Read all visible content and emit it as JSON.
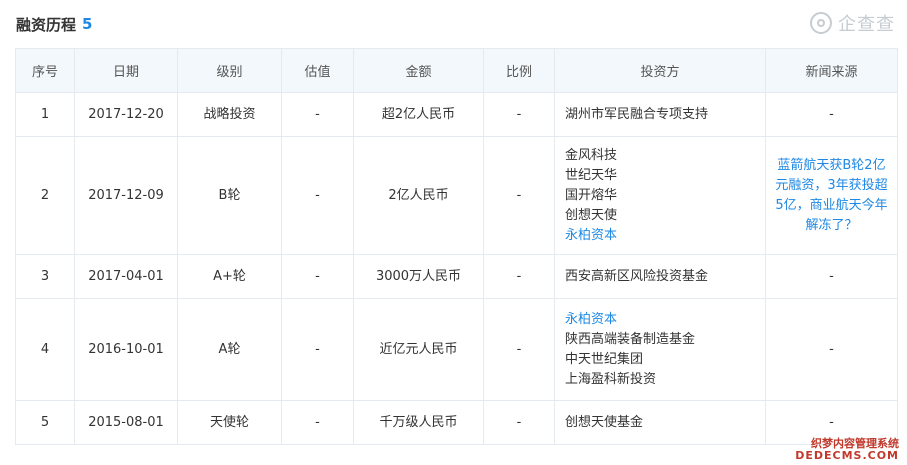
{
  "header": {
    "title": "融资历程",
    "count": "5"
  },
  "logo": {
    "text": "企查查"
  },
  "table": {
    "columns": [
      "序号",
      "日期",
      "级别",
      "估值",
      "金额",
      "比例",
      "投资方",
      "新闻来源"
    ],
    "rows": [
      {
        "index": "1",
        "date": "2017-12-20",
        "round": "战略投资",
        "valuation": "-",
        "amount": "超2亿人民币",
        "ratio": "-",
        "investors": [
          {
            "name": "湖州市军民融合专项支持",
            "link": false
          }
        ],
        "news": "-",
        "news_is_link": false
      },
      {
        "index": "2",
        "date": "2017-12-09",
        "round": "B轮",
        "valuation": "-",
        "amount": "2亿人民币",
        "ratio": "-",
        "investors": [
          {
            "name": "金风科技",
            "link": false
          },
          {
            "name": "世纪天华",
            "link": false
          },
          {
            "name": "国开熔华",
            "link": false
          },
          {
            "name": "创想天使",
            "link": false
          },
          {
            "name": "永柏资本",
            "link": true
          }
        ],
        "news": "蓝箭航天获B轮2亿元融资，3年获投超5亿，商业航天今年解冻了？",
        "news_is_link": true
      },
      {
        "index": "3",
        "date": "2017-04-01",
        "round": "A+轮",
        "valuation": "-",
        "amount": "3000万人民币",
        "ratio": "-",
        "investors": [
          {
            "name": "西安高新区风险投资基金",
            "link": false
          }
        ],
        "news": "-",
        "news_is_link": false
      },
      {
        "index": "4",
        "date": "2016-10-01",
        "round": "A轮",
        "valuation": "-",
        "amount": "近亿元人民币",
        "ratio": "-",
        "investors": [
          {
            "name": "永柏资本",
            "link": true
          },
          {
            "name": "陕西高端装备制造基金",
            "link": false
          },
          {
            "name": "中天世纪集团",
            "link": false
          },
          {
            "name": "上海盈科新投资",
            "link": false
          }
        ],
        "news": "-",
        "news_is_link": false
      },
      {
        "index": "5",
        "date": "2015-08-01",
        "round": "天使轮",
        "valuation": "-",
        "amount": "千万级人民币",
        "ratio": "-",
        "investors": [
          {
            "name": "创想天使基金",
            "link": false
          }
        ],
        "news": "-",
        "news_is_link": false
      }
    ]
  },
  "watermark": {
    "line1": "织梦内容管理系统",
    "line2": "DEDECMS.COM"
  },
  "colors": {
    "link": "#1e88e5",
    "header_bg": "#f2f8fc",
    "border": "#e4eaf0"
  }
}
